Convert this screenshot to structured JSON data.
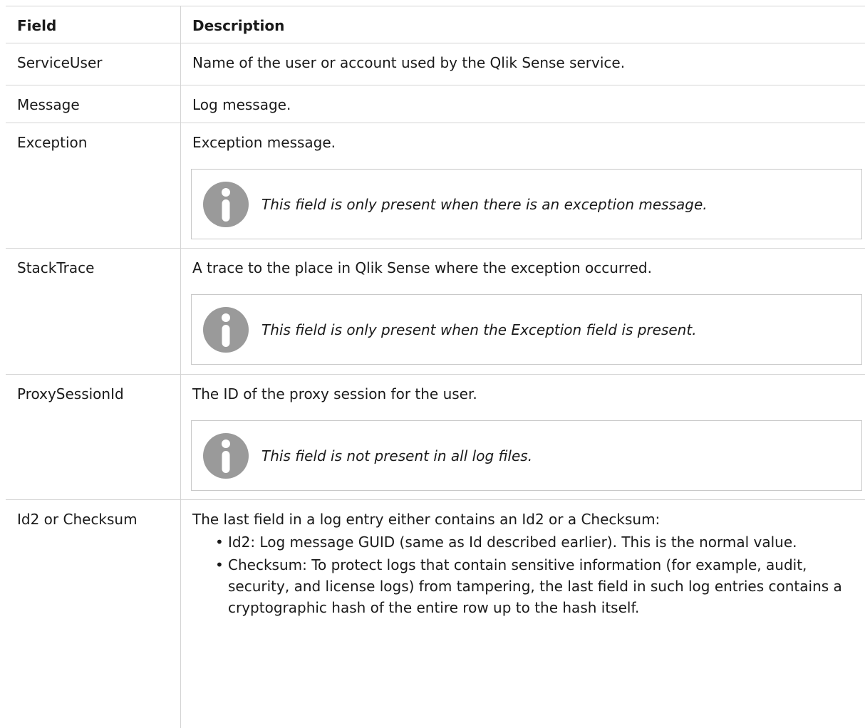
{
  "table": {
    "header": {
      "field": "Field",
      "description": "Description"
    },
    "rows": [
      {
        "field": "ServiceUser",
        "description": "Name of the user or account used by the Qlik Sense service."
      },
      {
        "field": "Message",
        "description": "Log message."
      },
      {
        "field": "Exception",
        "description": "Exception message.",
        "note": "This field is only present when there is an exception message."
      },
      {
        "field": "StackTrace",
        "description": "A trace to the place in Qlik Sense where the exception occurred.",
        "note": "This field is only present when the Exception field is present."
      },
      {
        "field": "ProxySessionId",
        "description": "The ID of the proxy session for the user.",
        "note": "This field is not present in all log files."
      },
      {
        "field": "Id2 or Checksum",
        "description": "The last field in a log entry either contains an Id2 or a Checksum:",
        "bullets": [
          "Id2: Log message GUID (same as Id described earlier). This is the normal value.",
          "Checksum: To protect logs that contain sensitive information (for example, audit, security, and license logs) from tampering, the last field in such log entries contains a cryptographic hash of the entire row up to the hash itself."
        ]
      }
    ]
  },
  "icons": {
    "note": "info-icon"
  },
  "colors": {
    "border": "#d4d4d4",
    "icon": "#9a9a9a",
    "text": "#1a1a1a"
  }
}
